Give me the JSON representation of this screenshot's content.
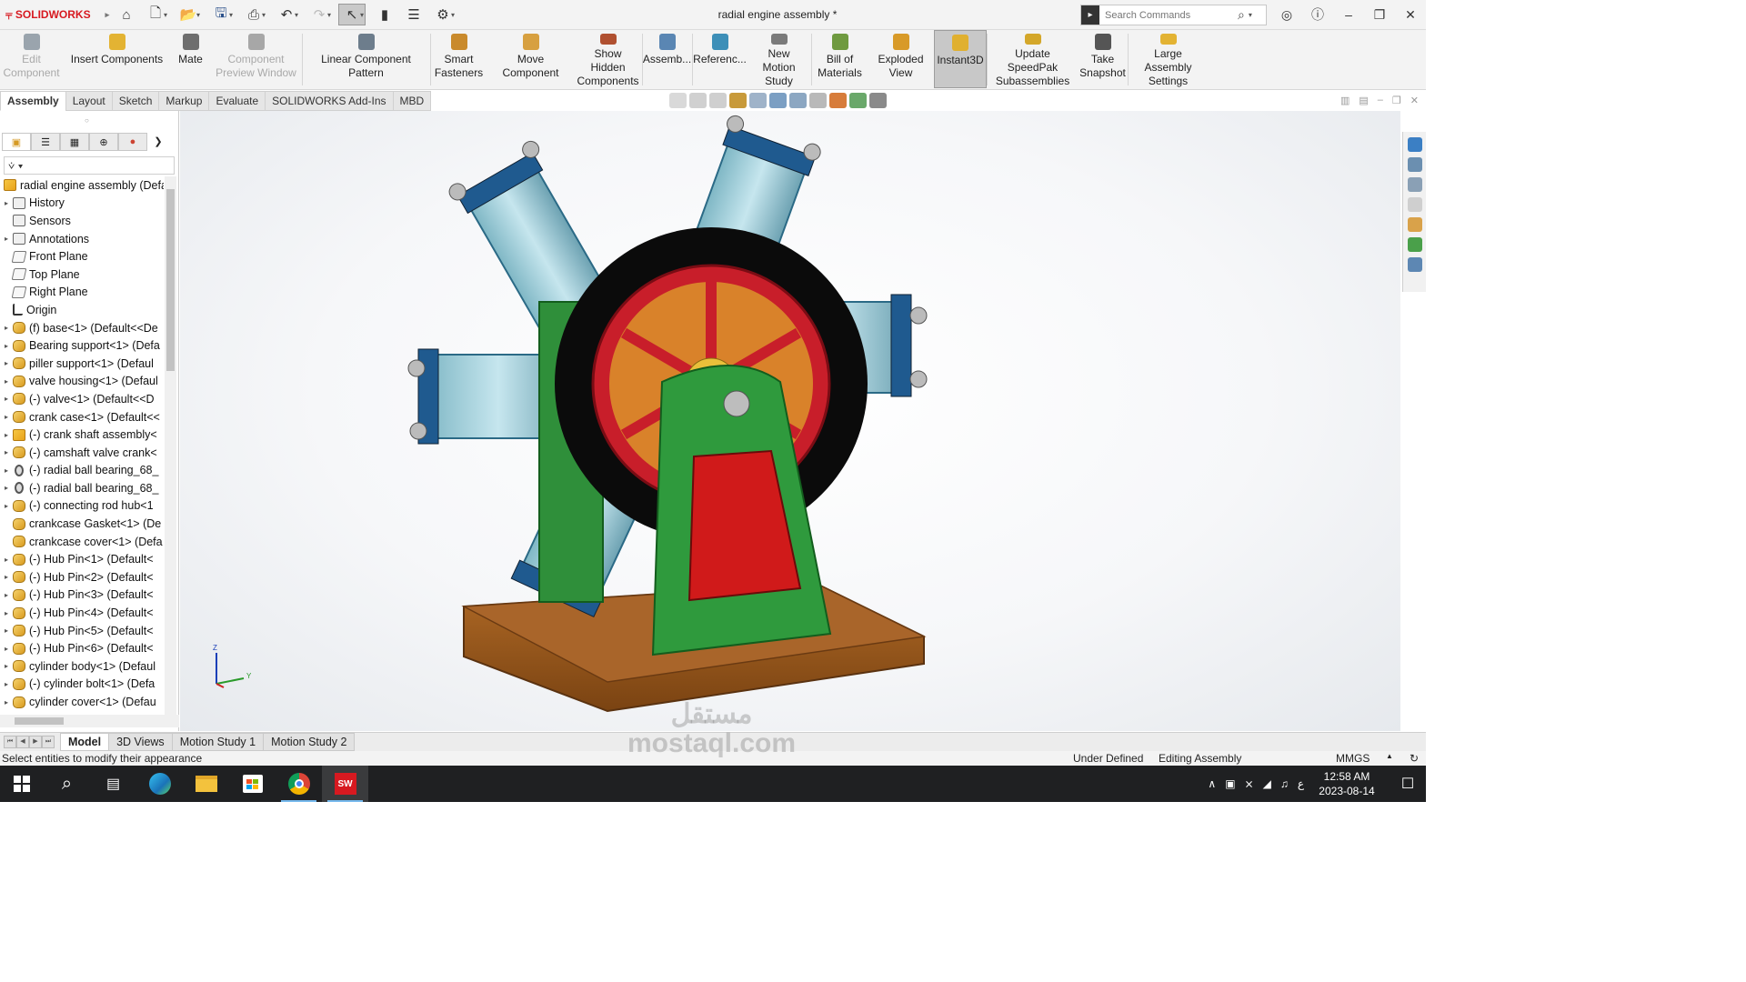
{
  "app": {
    "brand": "SOLIDWORKS",
    "document_title": "radial engine assembly *",
    "search_placeholder": "Search Commands"
  },
  "ribbon": {
    "buttons": [
      {
        "label": "Edit Component",
        "disabled": true,
        "color": "#9aa4ad"
      },
      {
        "label": "Insert Components",
        "disabled": false,
        "color": "#e3b333"
      },
      {
        "label": "Mate",
        "disabled": false,
        "color": "#6e6e6e"
      },
      {
        "label": "Component Preview Window",
        "disabled": true,
        "color": "#a7a7a7"
      },
      {
        "label": "Linear Component Pattern",
        "disabled": false,
        "color": "#6d7d8c"
      },
      {
        "label": "Smart Fasteners",
        "disabled": false,
        "color": "#c98a2c"
      },
      {
        "label": "Move Component",
        "disabled": false,
        "color": "#d7a040"
      },
      {
        "label": "Show Hidden Components",
        "disabled": false,
        "color": "#b05030"
      },
      {
        "label": "Assemb...",
        "disabled": false,
        "color": "#5a86b3"
      },
      {
        "label": "Referenc...",
        "disabled": false,
        "color": "#3d8fb8"
      },
      {
        "label": "New Motion Study",
        "disabled": false,
        "color": "#7a7a7a"
      },
      {
        "label": "Bill of Materials",
        "disabled": false,
        "color": "#6f9a40"
      },
      {
        "label": "Exploded View",
        "disabled": false,
        "color": "#d89a28"
      },
      {
        "label": "Instant3D",
        "disabled": false,
        "active": true,
        "color": "#e0b030"
      },
      {
        "label": "Update SpeedPak Subassemblies",
        "disabled": false,
        "color": "#d4a72a"
      },
      {
        "label": "Take Snapshot",
        "disabled": false,
        "color": "#555555"
      },
      {
        "label": "Large Assembly Settings",
        "disabled": false,
        "color": "#e3b333"
      }
    ]
  },
  "cm_tabs": [
    "Assembly",
    "Layout",
    "Sketch",
    "Markup",
    "Evaluate",
    "SOLIDWORKS Add-Ins",
    "MBD"
  ],
  "tree": {
    "root": "radial engine assembly  (Defa",
    "items": [
      {
        "label": "History",
        "icon": "folder",
        "expand": true
      },
      {
        "label": "Sensors",
        "icon": "folder",
        "expand": false
      },
      {
        "label": "Annotations",
        "icon": "folder",
        "expand": true
      },
      {
        "label": "Front Plane",
        "icon": "plane",
        "expand": false
      },
      {
        "label": "Top Plane",
        "icon": "plane",
        "expand": false
      },
      {
        "label": "Right Plane",
        "icon": "plane",
        "expand": false
      },
      {
        "label": "Origin",
        "icon": "origin",
        "expand": false
      },
      {
        "label": "(f) base<1> (Default<<De",
        "icon": "part",
        "expand": true
      },
      {
        "label": "Bearing support<1> (Defa",
        "icon": "part",
        "expand": true
      },
      {
        "label": "piller support<1> (Defaul",
        "icon": "part",
        "expand": true
      },
      {
        "label": "valve housing<1> (Defaul",
        "icon": "part",
        "expand": true
      },
      {
        "label": "(-) valve<1> (Default<<D",
        "icon": "part",
        "expand": true
      },
      {
        "label": "crank case<1> (Default<<",
        "icon": "part",
        "expand": true
      },
      {
        "label": "(-) crank shaft assembly<",
        "icon": "asm",
        "expand": true
      },
      {
        "label": "(-) camshaft valve crank<",
        "icon": "part",
        "expand": true
      },
      {
        "label": "(-) radial ball bearing_68_",
        "icon": "bear",
        "expand": true
      },
      {
        "label": "(-) radial ball bearing_68_",
        "icon": "bear",
        "expand": true
      },
      {
        "label": "(-) connecting rod hub<1",
        "icon": "part",
        "expand": true
      },
      {
        "label": "crankcase Gasket<1> (De",
        "icon": "part",
        "expand": false
      },
      {
        "label": "crankcase cover<1> (Defa",
        "icon": "part",
        "expand": false
      },
      {
        "label": "(-) Hub Pin<1> (Default<",
        "icon": "part",
        "expand": true
      },
      {
        "label": "(-) Hub Pin<2> (Default<",
        "icon": "part",
        "expand": true
      },
      {
        "label": "(-) Hub Pin<3> (Default<",
        "icon": "part",
        "expand": true
      },
      {
        "label": "(-) Hub Pin<4> (Default<",
        "icon": "part",
        "expand": true
      },
      {
        "label": "(-) Hub Pin<5> (Default<",
        "icon": "part",
        "expand": true
      },
      {
        "label": "(-) Hub Pin<6> (Default<",
        "icon": "part",
        "expand": true
      },
      {
        "label": "cylinder body<1> (Defaul",
        "icon": "part",
        "expand": true
      },
      {
        "label": "(-) cylinder bolt<1> (Defa",
        "icon": "part",
        "expand": true
      },
      {
        "label": "cylinder cover<1> (Defau",
        "icon": "part",
        "expand": true
      }
    ]
  },
  "bottom_tabs": [
    "Model",
    "3D Views",
    "Motion Study 1",
    "Motion Study 2"
  ],
  "status": {
    "message": "Select entities to modify their appearance",
    "definition": "Under Defined",
    "mode": "Editing Assembly",
    "units": "MMGS"
  },
  "triad": {
    "x": "Y",
    "z": "Z"
  },
  "taskbar": {
    "time": "12:58 AM",
    "date": "2023-08-14",
    "lang": "ع"
  },
  "watermark": {
    "arabic": "مستقل",
    "latin": "mostaql.com"
  }
}
